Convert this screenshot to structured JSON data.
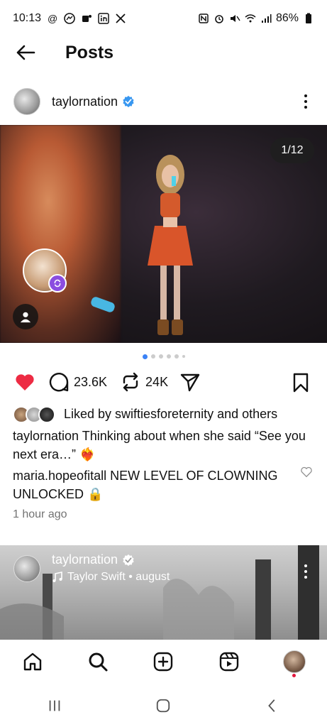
{
  "status_bar": {
    "time": "10:13",
    "battery": "86%",
    "left_icons": [
      "threads-icon",
      "messenger-icon",
      "teams-icon",
      "linkedin-icon",
      "x-icon"
    ],
    "right_icons": [
      "nfc-icon",
      "alarm-icon",
      "mute-icon",
      "wifi-icon",
      "signal-icon",
      "battery-icon"
    ]
  },
  "header": {
    "title": "Posts"
  },
  "post": {
    "username": "taylornation",
    "verified": true,
    "counter": "1/12",
    "like_count": "",
    "comment_count": "23.6K",
    "repost_count": "24K",
    "liked_by": "Liked by swiftiesforeternity and others",
    "caption_user": "taylornation",
    "caption_text": " Thinking about when she said “See you next era…” ❤️‍🔥",
    "comment_user": "maria.hopeofitall",
    "comment_text": " NEW LEVEL OF CLOWNING UNLOCKED 🔒",
    "time_ago": "1 hour ago",
    "carousel_dots": 6,
    "active_dot": 0
  },
  "second_post": {
    "username": "taylornation",
    "audio": "Taylor Swift • august"
  },
  "colors": {
    "like_red": "#ed2b43",
    "verified_blue": "#3897f0",
    "active_dot": "#3b82f6",
    "muted_text": "#737373"
  }
}
